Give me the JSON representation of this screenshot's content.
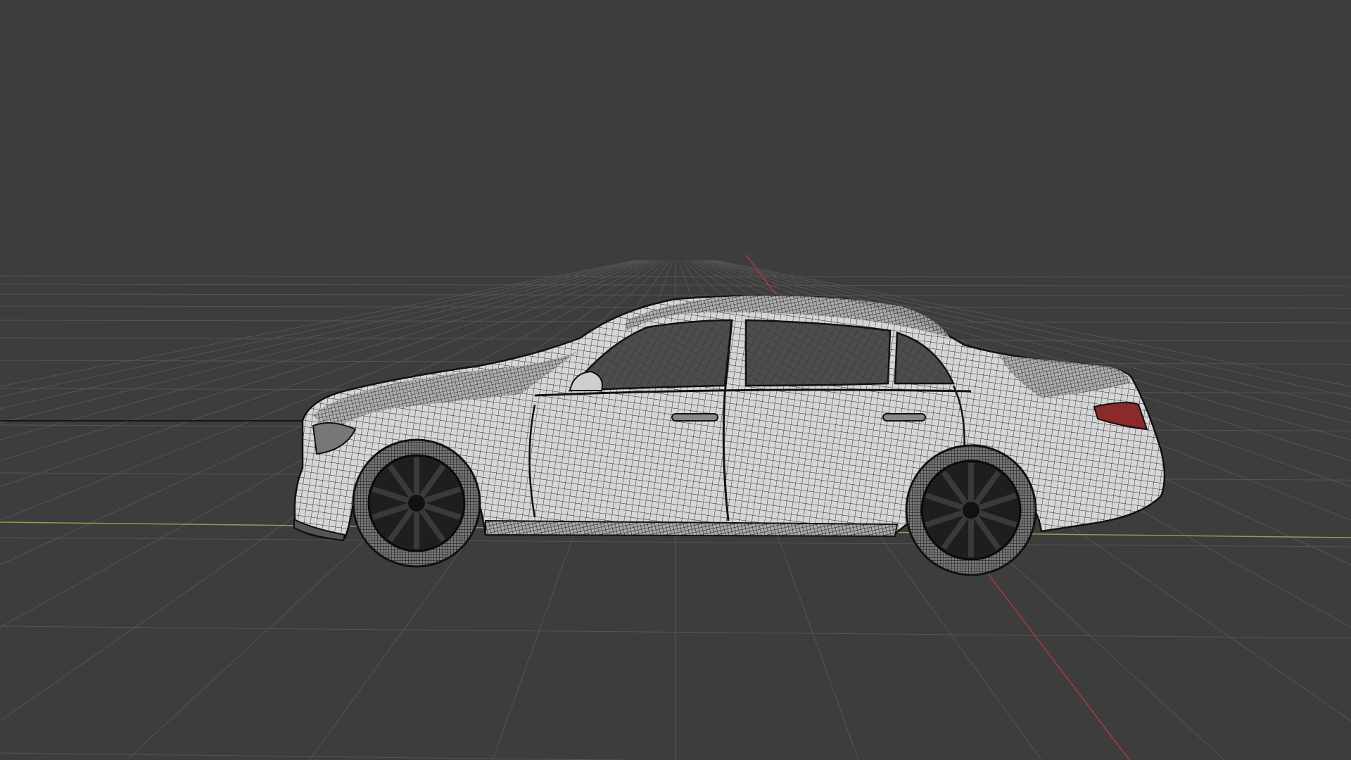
{
  "viewport": {
    "mode": "wireframe",
    "background_color": "#3d3d3d",
    "grid_color": "#555555",
    "axis_x_color": "#b03a3a",
    "axis_y_color": "#8aa04a",
    "horizon_line_color": "#1a1a1a"
  },
  "scene": {
    "object": "sedan-car",
    "body_color": "#d8d8d8",
    "wire_color": "#1c1c1c",
    "glass_color": "#4a4a4a",
    "wheel_color": "#1e1e1e",
    "taillight_color": "#8a2a2a"
  }
}
